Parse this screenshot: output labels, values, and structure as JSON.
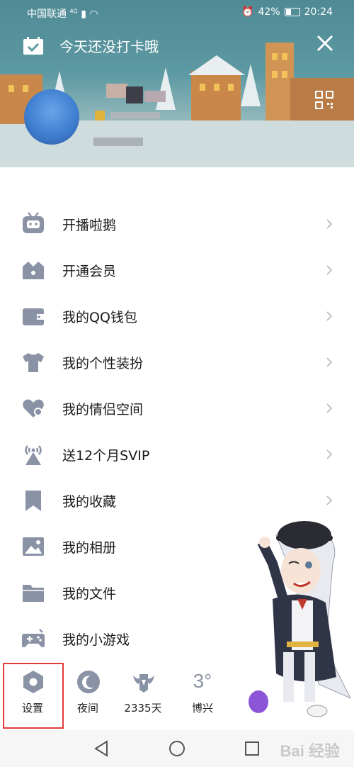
{
  "status_bar": {
    "carrier": "中国联通",
    "network": "4G",
    "battery": "42%",
    "time": "20:24"
  },
  "header": {
    "checkin_text": "今天还没打卡哦"
  },
  "menu": {
    "items": [
      {
        "label": "开播啦鹅",
        "icon": "tv-bot-icon",
        "chevron": true
      },
      {
        "label": "开通会员",
        "icon": "crown-icon",
        "chevron": true
      },
      {
        "label": "我的QQ钱包",
        "icon": "wallet-icon",
        "chevron": true
      },
      {
        "label": "我的个性装扮",
        "icon": "tshirt-icon",
        "chevron": true
      },
      {
        "label": "我的情侣空间",
        "icon": "couple-heart-icon",
        "chevron": true
      },
      {
        "label": "送12个月SVIP",
        "icon": "broadcast-icon",
        "chevron": true
      },
      {
        "label": "我的收藏",
        "icon": "bookmark-icon",
        "chevron": true
      },
      {
        "label": "我的相册",
        "icon": "photo-icon",
        "chevron": false
      },
      {
        "label": "我的文件",
        "icon": "folder-icon",
        "chevron": false
      },
      {
        "label": "我的小游戏",
        "icon": "gamepad-icon",
        "chevron": false
      }
    ]
  },
  "bottom_bar": {
    "settings": "设置",
    "night": "夜间",
    "days": "2335天",
    "weather_temp": "3°",
    "weather_city": "博兴"
  },
  "watermark": "Bai 经验",
  "colors": {
    "icon_gray": "#8a93a5",
    "highlight_red": "#e53a3a",
    "header_teal": "#5e9aa3"
  }
}
